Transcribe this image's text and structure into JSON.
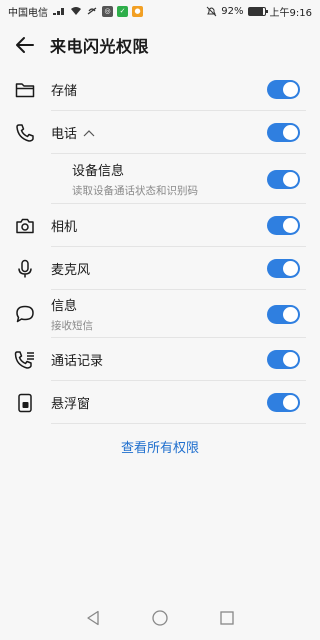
{
  "status_bar": {
    "carrier": "中国电信",
    "signal_tag": "4G",
    "battery": "92%",
    "time": "上午9:16"
  },
  "app_bar": {
    "title": "来电闪光权限"
  },
  "permissions": [
    {
      "label": "存储",
      "icon": "folder-icon",
      "enabled": true
    },
    {
      "label": "电话",
      "icon": "phone-icon",
      "enabled": true,
      "expanded": true
    },
    {
      "label": "设备信息",
      "desc": "读取设备通话状态和识别码",
      "enabled": true,
      "sub": true
    },
    {
      "label": "相机",
      "icon": "camera-icon",
      "enabled": true
    },
    {
      "label": "麦克风",
      "icon": "microphone-icon",
      "enabled": true
    },
    {
      "label": "信息",
      "desc": "接收短信",
      "icon": "message-icon",
      "enabled": true
    },
    {
      "label": "通话记录",
      "icon": "call-log-icon",
      "enabled": true
    },
    {
      "label": "悬浮窗",
      "icon": "floating-window-icon",
      "enabled": true
    }
  ],
  "view_all": "查看所有权限",
  "colors": {
    "accent": "#2f7fe0",
    "link": "#1f6fce",
    "background": "#f7f7f7"
  }
}
